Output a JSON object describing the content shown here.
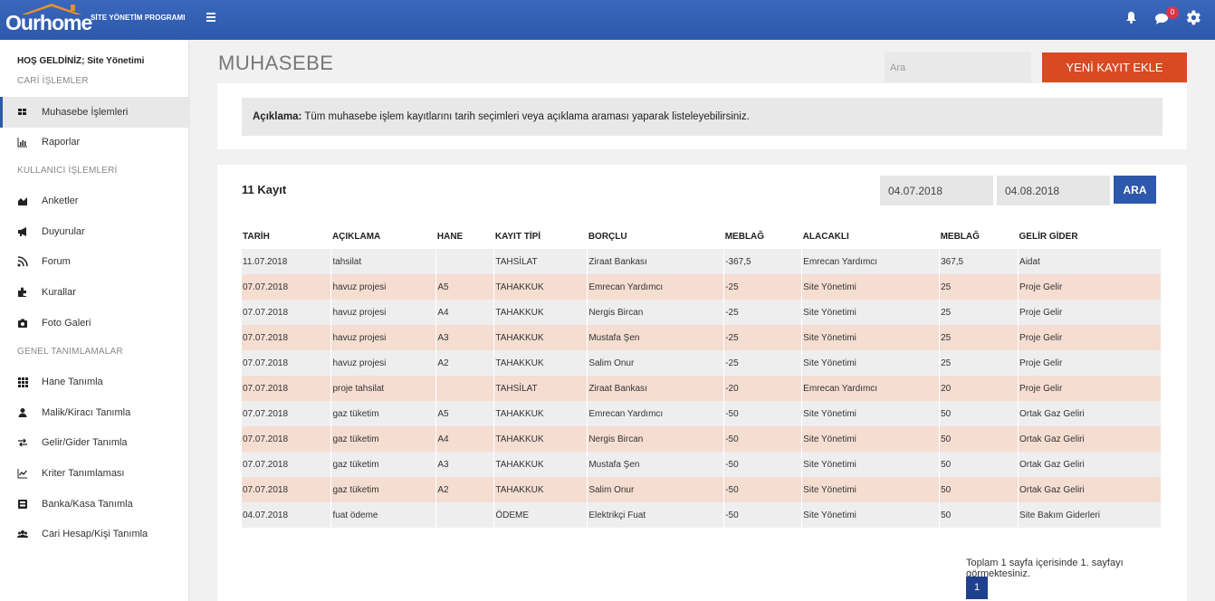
{
  "header": {
    "logo_main": "Ourhome",
    "logo_sub": "SİTE YÖNETİM PROGRAMI",
    "notification_count": "0"
  },
  "sidebar": {
    "welcome": "HOŞ GELDİNİZ; Site Yönetimi",
    "sections": [
      {
        "title": "CARİ İŞLEMLER"
      },
      {
        "title": "KULLANICI İŞLEMLERİ"
      },
      {
        "title": "GENEL TANIMLAMALAR"
      }
    ],
    "items": [
      {
        "label": "Muhasebe İşlemleri",
        "icon": "grid-icon"
      },
      {
        "label": "Raporlar",
        "icon": "bar-chart-icon"
      },
      {
        "label": "Anketler",
        "icon": "area-chart-icon"
      },
      {
        "label": "Duyurular",
        "icon": "megaphone-icon"
      },
      {
        "label": "Forum",
        "icon": "rss-icon"
      },
      {
        "label": "Kurallar",
        "icon": "puzzle-icon"
      },
      {
        "label": "Foto Galeri",
        "icon": "camera-icon"
      },
      {
        "label": "Hane Tanımla",
        "icon": "th-icon"
      },
      {
        "label": "Malik/Kiracı Tanımla",
        "icon": "user-icon"
      },
      {
        "label": "Gelir/Gider Tanımla",
        "icon": "exchange-icon"
      },
      {
        "label": "Kriter Tanımlaması",
        "icon": "line-chart-icon"
      },
      {
        "label": "Banka/Kasa Tanımla",
        "icon": "bank-icon"
      },
      {
        "label": "Cari Hesap/Kişi Tanımla",
        "icon": "users-icon"
      }
    ]
  },
  "main": {
    "title": "MUHASEBE",
    "search_placeholder": "Ara",
    "new_button": "YENİ KAYIT EKLE",
    "desc_label": "Açıklama:",
    "desc_text": " Tüm muhasebe işlem kayıtlarını tarih seçimleri veya açıklama araması yaparak listeleyebilirsiniz.",
    "record_count": "11 Kayıt",
    "date_from": "04.07.2018",
    "date_to": "04.08.2018",
    "search_button": "ARA",
    "columns": [
      "TARİH",
      "AÇIKLAMA",
      "HANE",
      "KAYIT TİPİ",
      "BORÇLU",
      "MEBLAĞ",
      "ALACAKLI",
      "MEBLAĞ",
      "GELİR GİDER"
    ],
    "rows": [
      [
        "11.07.2018",
        "tahsilat",
        "",
        "TAHSİLAT",
        "Ziraat Bankası",
        "-367,5",
        "Emrecan Yardımcı",
        "367,5",
        "Aidat"
      ],
      [
        "07.07.2018",
        "havuz projesi",
        "A5",
        "TAHAKKUK",
        "Emrecan Yardımcı",
        "-25",
        "Site Yönetimi",
        "25",
        "Proje Gelir"
      ],
      [
        "07.07.2018",
        "havuz projesi",
        "A4",
        "TAHAKKUK",
        "Nergis Bircan",
        "-25",
        "Site Yönetimi",
        "25",
        "Proje Gelir"
      ],
      [
        "07.07.2018",
        "havuz projesi",
        "A3",
        "TAHAKKUK",
        "Mustafa Şen",
        "-25",
        "Site Yönetimi",
        "25",
        "Proje Gelir"
      ],
      [
        "07.07.2018",
        "havuz projesi",
        "A2",
        "TAHAKKUK",
        "Salim Onur",
        "-25",
        "Site Yönetimi",
        "25",
        "Proje Gelir"
      ],
      [
        "07.07.2018",
        "proje tahsilat",
        "",
        "TAHSİLAT",
        "Ziraat Bankası",
        "-20",
        "Emrecan Yardımcı",
        "20",
        "Proje Gelir"
      ],
      [
        "07.07.2018",
        "gaz tüketim",
        "A5",
        "TAHAKKUK",
        "Emrecan Yardımcı",
        "-50",
        "Site Yönetimi",
        "50",
        "Ortak Gaz Geliri"
      ],
      [
        "07.07.2018",
        "gaz tüketim",
        "A4",
        "TAHAKKUK",
        "Nergis Bircan",
        "-50",
        "Site Yönetimi",
        "50",
        "Ortak Gaz Geliri"
      ],
      [
        "07.07.2018",
        "gaz tüketim",
        "A3",
        "TAHAKKUK",
        "Mustafa Şen",
        "-50",
        "Site Yönetimi",
        "50",
        "Ortak Gaz Geliri"
      ],
      [
        "07.07.2018",
        "gaz tüketim",
        "A2",
        "TAHAKKUK",
        "Salim Onur",
        "-50",
        "Site Yönetimi",
        "50",
        "Ortak Gaz Geliri"
      ],
      [
        "04.07.2018",
        "fuat ödeme",
        "",
        "ÖDEME",
        "Elektrikçi Fuat",
        "-50",
        "Site Yönetimi",
        "50",
        "Site Bakım Giderleri"
      ]
    ],
    "pager_text": "Toplam 1 sayfa içerisinde 1. sayfayı görmektesiniz.",
    "current_page": "1"
  },
  "colors": {
    "primary": "#2d58ab",
    "accent": "#d84a22",
    "row_highlight": "#f5ddd2"
  }
}
